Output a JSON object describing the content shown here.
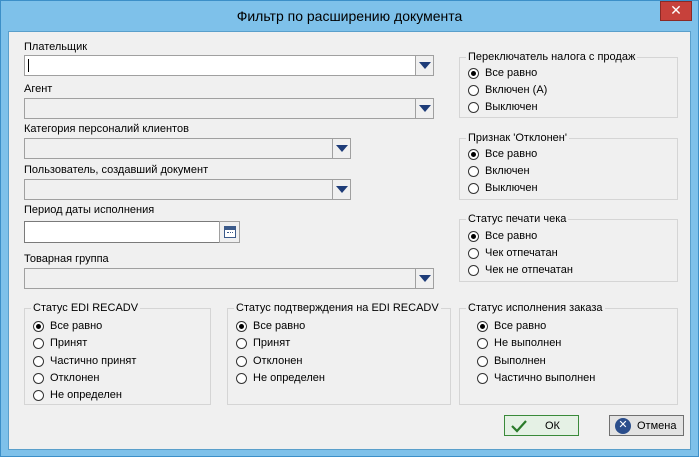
{
  "window": {
    "title": "Фильтр по расширению документа",
    "close_glyph": "✕"
  },
  "fields": {
    "payer": {
      "label": "Плательщик",
      "value": ""
    },
    "agent": {
      "label": "Агент",
      "value": ""
    },
    "personal_category": {
      "label": "Категория персоналий клиентов",
      "value": ""
    },
    "creator_user": {
      "label": "Пользователь, создавший документ",
      "value": ""
    },
    "execution_period": {
      "label": "Период даты исполнения",
      "value": ""
    },
    "product_group": {
      "label": "Товарная группа",
      "value": ""
    }
  },
  "groups": {
    "sales_tax": {
      "title": "Переключатель налога с продаж",
      "options": [
        "Все равно",
        "Включен (А)",
        "Выключен"
      ],
      "selected": 0
    },
    "rejected": {
      "title": "Признак 'Отклонен'",
      "options": [
        "Все равно",
        "Включен",
        "Выключен"
      ],
      "selected": 0
    },
    "receipt_print": {
      "title": "Статус печати чека",
      "options": [
        "Все равно",
        "Чек отпечатан",
        "Чек не отпечатан"
      ],
      "selected": 0
    },
    "edi_recadv": {
      "title": "Статус EDI RECADV",
      "options": [
        "Все равно",
        "Принят",
        "Частично принят",
        "Отклонен",
        "Не определен"
      ],
      "selected": 0
    },
    "edi_confirm": {
      "title": "Статус подтверждения на EDI RECADV",
      "options": [
        "Все равно",
        "Принят",
        "Отклонен",
        "Не определен"
      ],
      "selected": 0
    },
    "order_exec": {
      "title": "Статус исполнения заказа",
      "options": [
        "Все равно",
        "Не выполнен",
        "Выполнен",
        "Частично выполнен"
      ],
      "selected": 0
    }
  },
  "buttons": {
    "ok": "ОК",
    "cancel": "Отмена"
  },
  "icons": {
    "dropdown": "chevron-down-icon",
    "calendar": "calendar-icon",
    "ok": "checkmark-icon",
    "cancel": "close-circle-icon"
  },
  "colors": {
    "titlebar": "#7ec1ea",
    "close": "#c7413b",
    "ok_accent": "#3a8a3a",
    "cancel_accent": "#2b4e8c"
  }
}
